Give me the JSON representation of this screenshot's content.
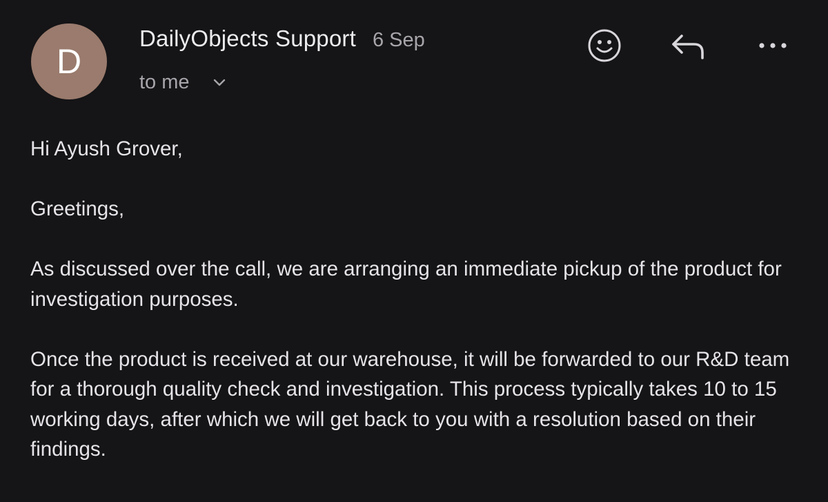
{
  "header": {
    "avatar_letter": "D",
    "sender_name": "DailyObjects Support",
    "date": "6 Sep",
    "recipient": "to me"
  },
  "icons": {
    "emoji": "smiley-face-icon",
    "reply": "reply-arrow-icon",
    "more": "more-horizontal-icon",
    "expand": "chevron-down-icon"
  },
  "colors": {
    "background": "#151416",
    "avatar": "#9a7b6d",
    "primary_text": "#e6e4e8",
    "secondary_text": "#a7a5aa"
  },
  "body": {
    "salutation": "Hi Ayush Grover,",
    "greeting": "Greetings,",
    "paragraph_1": "As discussed over the call, we are arranging an immediate pickup of the product for investigation purposes.",
    "paragraph_2": "Once the product is received at our warehouse, it will be forwarded to our R&D team for a thorough quality check and investigation. This process typically takes 10 to 15 working days, after which we will get back to you with a resolution based on their findings."
  }
}
